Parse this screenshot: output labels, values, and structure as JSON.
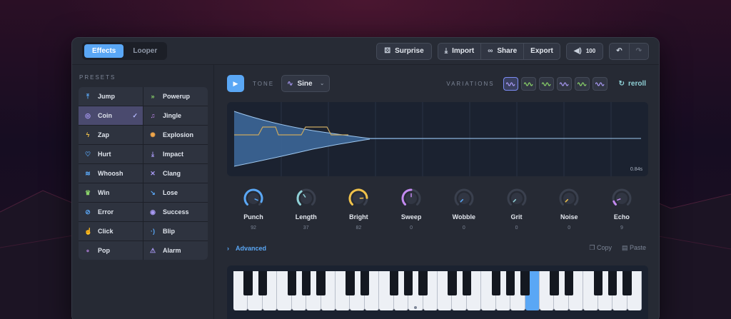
{
  "tabs": [
    {
      "label": "Effects",
      "active": true
    },
    {
      "label": "Looper",
      "active": false
    }
  ],
  "toolbar": {
    "surprise": "Surprise",
    "import": "Import",
    "share": "Share",
    "export": "Export",
    "volume": "100"
  },
  "presets_label": "PRESETS",
  "presets": [
    {
      "label": "Jump",
      "icon": "arrow-up-icon",
      "glyph": "⤒",
      "color": "#5aa7f5"
    },
    {
      "label": "Powerup",
      "icon": "chevrons-up-icon",
      "glyph": "»",
      "color": "#8bd46a"
    },
    {
      "label": "Coin",
      "icon": "coin-icon",
      "glyph": "◎",
      "color": "#a99af5",
      "selected": true
    },
    {
      "label": "Jingle",
      "icon": "bell-icon",
      "glyph": "♫",
      "color": "#c38af0"
    },
    {
      "label": "Zap",
      "icon": "bolt-icon",
      "glyph": "ϟ",
      "color": "#f0c24a"
    },
    {
      "label": "Explosion",
      "icon": "burst-icon",
      "glyph": "✺",
      "color": "#f0a64a"
    },
    {
      "label": "Hurt",
      "icon": "heart-crack-icon",
      "glyph": "♡",
      "color": "#5aa7f5"
    },
    {
      "label": "Impact",
      "icon": "impact-icon",
      "glyph": "⤓",
      "color": "#a99af5"
    },
    {
      "label": "Whoosh",
      "icon": "wind-icon",
      "glyph": "≋",
      "color": "#5aa7f5"
    },
    {
      "label": "Clang",
      "icon": "swords-icon",
      "glyph": "✕",
      "color": "#a99af5"
    },
    {
      "label": "Win",
      "icon": "trophy-icon",
      "glyph": "♛",
      "color": "#8bd46a"
    },
    {
      "label": "Lose",
      "icon": "trend-down-icon",
      "glyph": "↘",
      "color": "#5aa7f5"
    },
    {
      "label": "Error",
      "icon": "ban-icon",
      "glyph": "⊘",
      "color": "#5aa7f5"
    },
    {
      "label": "Success",
      "icon": "check-circle-icon",
      "glyph": "◉",
      "color": "#a99af5"
    },
    {
      "label": "Click",
      "icon": "pointer-icon",
      "glyph": "☝",
      "color": "#5aa7f5"
    },
    {
      "label": "Blip",
      "icon": "signal-icon",
      "glyph": "·)",
      "color": "#5aa7f5"
    },
    {
      "label": "Pop",
      "icon": "bubbles-icon",
      "glyph": "∘",
      "color": "#c38af0"
    },
    {
      "label": "Alarm",
      "icon": "siren-icon",
      "glyph": "⚠",
      "color": "#a99af5"
    }
  ],
  "tone_label": "TONE",
  "tone": "Sine",
  "variations_label": "VARIATIONS",
  "variation_colors": [
    "#a99af5",
    "#8bd46a",
    "#8bd46a",
    "#a99af5",
    "#8bd46a",
    "#a99af5"
  ],
  "reroll": "reroll",
  "duration": "0.84s",
  "knobs": [
    {
      "label": "Punch",
      "value": "92",
      "level": 0.92,
      "color": "#5aa7f5"
    },
    {
      "label": "Length",
      "value": "37",
      "level": 0.37,
      "color": "#8fd0d6"
    },
    {
      "label": "Bright",
      "value": "82",
      "level": 0.82,
      "color": "#f0c24a"
    },
    {
      "label": "Sweep",
      "value": "0",
      "level": 0.5,
      "color": "#c38af0"
    },
    {
      "label": "Wobble",
      "value": "0",
      "level": 0,
      "color": "#5aa7f5"
    },
    {
      "label": "Grit",
      "value": "0",
      "level": 0,
      "color": "#8fd0d6"
    },
    {
      "label": "Noise",
      "value": "0",
      "level": 0,
      "color": "#f0c24a"
    },
    {
      "label": "Echo",
      "value": "9",
      "level": 0.09,
      "color": "#c38af0"
    }
  ],
  "advanced": "Advanced",
  "copy": "Copy",
  "paste": "Paste",
  "piano": {
    "white_keys": 28,
    "active_white_key": 20,
    "marked_white_key": 12
  }
}
